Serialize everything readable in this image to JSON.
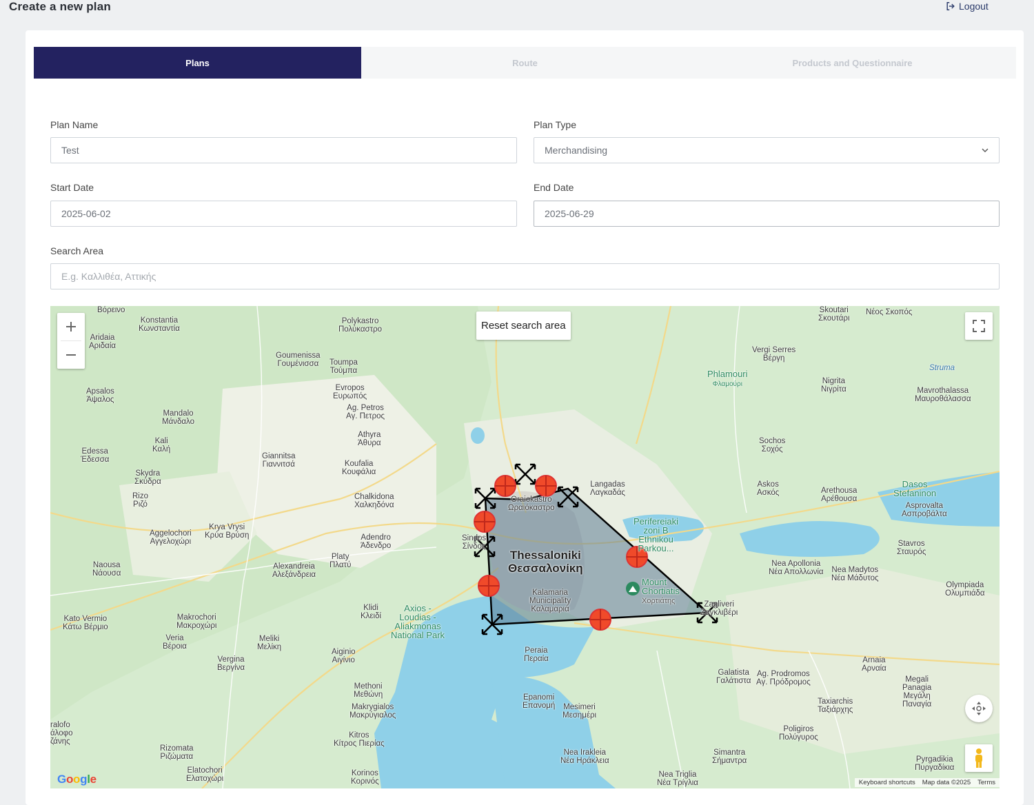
{
  "header": {
    "title": "Create a new plan",
    "logout_label": "Logout"
  },
  "tabs": [
    {
      "label": "Plans",
      "active": true
    },
    {
      "label": "Route",
      "active": false
    },
    {
      "label": "Products and Questionnaire",
      "active": false
    }
  ],
  "form": {
    "plan_name": {
      "label": "Plan Name",
      "value": "Test"
    },
    "plan_type": {
      "label": "Plan Type",
      "value": "Merchandising"
    },
    "start_date": {
      "label": "Start Date",
      "value": "2025-06-02"
    },
    "end_date": {
      "label": "End Date",
      "value": "2025-06-29"
    },
    "search_area": {
      "label": "Search Area",
      "placeholder": "E.g. Καλλιθέα, Αττικής"
    }
  },
  "map": {
    "reset_label": "Reset search area",
    "google": "Google",
    "footer": {
      "shortcuts": "Keyboard shortcuts",
      "data": "Map data ©2025",
      "terms": "Terms"
    },
    "labels": {
      "thessaloniki": "Thessaloniki",
      "thessaloniki_gr": "Θεσσαλονίκη",
      "oraiokastro": "Oraiokastro",
      "oraiokastro_gr": "Ωραιόκαστρο",
      "kalamaria": "Kalamaria",
      "kalamaria_2": "Municipality",
      "kalamaria_gr": "Καλαμαριά",
      "langadas": "Langadas",
      "langadas_gr": "Λαγκαδάς",
      "axios": "Axios -",
      "axios_2": "Loudias -",
      "axios_3": "Aliakmonas",
      "axios_4": "National Park",
      "chortiatis": "Mount",
      "chortiatis_2": "Chortiatis",
      "chortiatis_gr": "Χορτιάτης",
      "periferiaki": "Perifereiaki",
      "periferiaki_2": "zoni B",
      "periferiaki_3": "Ethnikou",
      "periferiaki_4": "Parkou...",
      "peraia": "Peraia",
      "peraia_gr": "Περαία",
      "sindos": "Sindos",
      "sindos_gr": "Σίνδος",
      "chalkidona": "Chalkidona",
      "chalkidona_gr": "Χαλκηδόνα",
      "polykastro": "Polykastro",
      "polykastro_gr": "Πολύκαστρο",
      "kilkis": "Goumenissa",
      "kilkis_gr": "Γουμένισσα",
      "konstantia": "Konstantia",
      "konstantia_gr": "Κωνσταντία",
      "aridaia": "Aridaia",
      "aridaia_gr": "Αριδαία",
      "edessa": "Edessa",
      "edessa_gr": "Έδεσσα",
      "giannitsa": "Giannitsa",
      "giannitsa_gr": "Γιαννιτσά",
      "veria": "Veria",
      "veria_gr": "Βέροια",
      "naousa": "Naousa",
      "naousa_gr": "Νάουσα",
      "alexandreia": "Alexandreia",
      "alexandreia_gr": "Αλεξάνδρεια",
      "platy": "Platy",
      "platy_gr": "Πλατύ",
      "adendro": "Adendro",
      "adendro_gr": "Άδενδρο",
      "klidi": "Klidi",
      "klidi_gr": "Κλειδί",
      "aiginio": "Aiginio",
      "aiginio_gr": "Αιγίνιο",
      "methoni": "Methoni",
      "methoni_gr": "Μεθώνη",
      "katerini": "Korinos",
      "katerini_gr": "Κορινός",
      "epanomi": "Epanomi",
      "epanomi_gr": "Επανομή",
      "mesimeri": "Mesimeri",
      "mesimeri_gr": "Μεσημέρι",
      "nea_irakleia": "Nea Irakleia",
      "nea_irakleia_gr": "Νέα Ηράκλεια",
      "galatista": "Galatista",
      "galatista_gr": "Γαλάτιστα",
      "nea_apollonia": "Nea Apollonia",
      "nea_apollonia_gr": "Νέα Απολλωνία",
      "nea_madytos": "Nea Madytos",
      "nea_madytos_gr": "Νέα Μάδυτος",
      "sochos": "Sochos",
      "sochos_gr": "Σοχός",
      "askos": "Askos",
      "askos_gr": "Ασκός",
      "nigrita": "Nigrita",
      "nigrita_gr": "Νιγρίτα",
      "vergi": "Vergi Serres",
      "vergi_gr": "Βέργη",
      "phlamouri": "Phlamouri",
      "phlamouri_gr": "Φλαμούρι",
      "mavrothalassa": "Mavrothalassa",
      "mavrothalassa_gr": "Μαυροθάλασσα",
      "olympiada": "Olympiada",
      "olympiada_gr": "Ολυμπιάδα",
      "stavros": "Stavros",
      "stavros_gr": "Σταυρός",
      "arnaia": "Arnaia",
      "arnaia_gr": "Αρναία",
      "poligyros": "Poligiros",
      "poligyros_gr": "Πολύγυρος",
      "zagliveri": "Zagliveri",
      "zagliveri_gr": "Ζαγκλιβέρι",
      "kato_vermio": "Kato Vermio",
      "kato_vermio_gr": "Κάτω Βέρμιο",
      "makrochori": "Makrochori",
      "makrochori_gr": "Μακροχώρι",
      "meliki": "Meliki",
      "meliki_gr": "Μελίκη",
      "vergina": "Vergina",
      "vergina_gr": "Βεργίνα",
      "kitros": "Kitros",
      "kitros_gr": "Κίτρος Πιερίας",
      "makrygialos": "Makrygialos",
      "makrygialos_gr": "Μακρύγιαλος",
      "rizomata": "Rizomata",
      "rizomata_gr": "Ριζώματα",
      "elatochori": "Elatochori",
      "elatochori_gr": "Ελατοχώρι",
      "simantra": "Simantra",
      "simantra_gr": "Σήμαντρα",
      "pyrgadikia": "Pyrgadikia",
      "pyrgadikia_gr": "Πυργαδίκια",
      "nea_triglia": "Nea Triglia",
      "nea_triglia_gr": "Νέα Τρίγλια",
      "taxiarchis": "Taxiarchis",
      "taxiarchis_gr": "Ταξιάρχης",
      "ag_prodromos": "Ag. Prodromos",
      "ag_prodromos_gr": "Αγ. Πρόδρομος",
      "megali_panagia": "Megali",
      "megali_panagia_2": "Panagia",
      "megali_panagia_gr": "Μεγάλη",
      "megali_panagia_gr2": "Παναγία",
      "arethousa": "Arethousa",
      "arethousa_gr": "Αρέθουσα",
      "asprovalta": "Asprovalta",
      "asprovalta_gr": "Ασπροβάλτα",
      "dasos": "Dasos",
      "dasos_2": "Stefaninon",
      "strymon": "Struma",
      "skoutari": "Skoutari",
      "skoutari_gr": "Σκουτάρι",
      "neos_skopos": "Νέος Σκοπός",
      "evropos": "Evropos",
      "evropos_gr": "Ευρωπός",
      "toumpa": "Toumpa",
      "toumpa_gr": "Τούμπα",
      "ag_petros": "Ag. Petros",
      "ag_petros_gr": "Αγ. Πετρος",
      "athyra": "Athyra",
      "athyra_gr": "Άθυρα",
      "koufalia": "Koufalia",
      "koufalia_gr": "Κουφάλια",
      "krya_vrysi": "Krya Vrysi",
      "krya_vrysi_gr": "Κρύα Βρύση",
      "agelochori": "Aggelochori",
      "agelochori_gr": "Αγγελοχώρι",
      "rizo": "Rizo",
      "rizo_gr": "Ριζό",
      "skydra": "Skydra",
      "skydra_gr": "Σκύδρα",
      "kali": "Kali",
      "kali_gr": "Καλή",
      "mandalo": "Mandalo",
      "mandalo_gr": "Μάνδαλο",
      "apsalos": "Apsalos",
      "apsalos_gr": "Άψαλος",
      "vorino": "Βόρεινο",
      "ralofo": "ralofo",
      "ralofo_gr": "άλοφο",
      "zanes": "ζάνης"
    }
  }
}
